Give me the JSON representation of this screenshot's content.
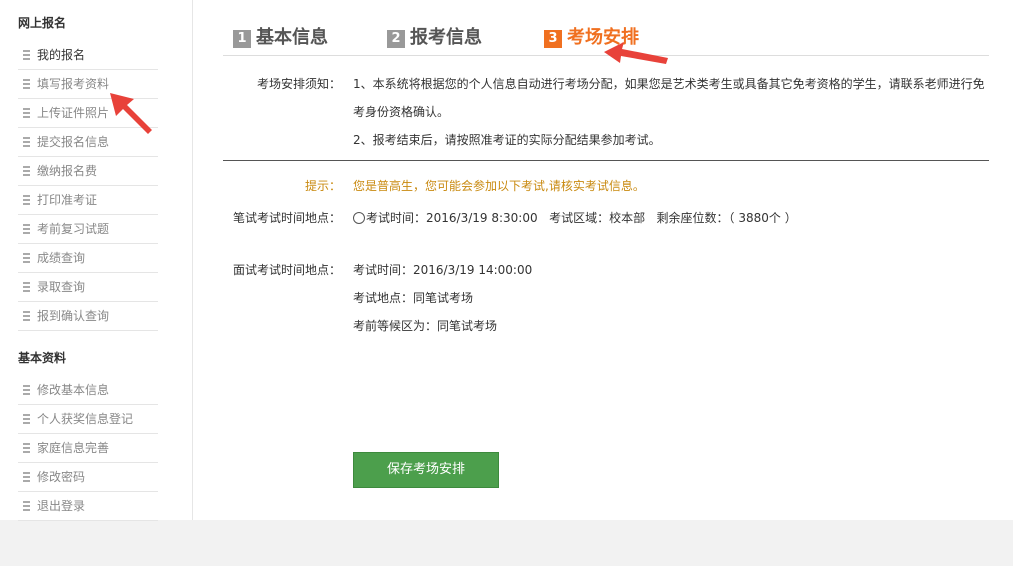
{
  "sidebar": {
    "section1_title": "网上报名",
    "section1_items": [
      "我的报名",
      "填写报考资料",
      "上传证件照片",
      "提交报名信息",
      "缴纳报名费",
      "打印准考证",
      "考前复习试题",
      "成绩查询",
      "录取查询",
      "报到确认查询"
    ],
    "section2_title": "基本资料",
    "section2_items": [
      "修改基本信息",
      "个人获奖信息登记",
      "家庭信息完善",
      "修改密码",
      "退出登录"
    ]
  },
  "steps": [
    {
      "num": "1",
      "label": "基本信息"
    },
    {
      "num": "2",
      "label": "报考信息"
    },
    {
      "num": "3",
      "label": "考场安排"
    }
  ],
  "notice": {
    "label": "考场安排须知：",
    "line1": "1、本系统将根据您的个人信息自动进行考场分配，如果您是艺术类考生或具备其它免考资格的学生，请联系老师进行免",
    "line1b": "考身份资格确认。",
    "line2": "2、报考结束后，请按照准考证的实际分配结果参加考试。"
  },
  "hint": {
    "label": "提示：",
    "text": "您是普高生，您可能会参加以下考试,请核实考试信息。"
  },
  "written": {
    "label": "笔试考试时间地点：",
    "time": "考试时间：2016/3/19 8:30:00",
    "area": "考试区域：校本部",
    "seats": "剩余座位数：（ 3880个 ）"
  },
  "interview": {
    "label": "面试考试时间地点：",
    "time": "考试时间：2016/3/19 14:00:00",
    "place": "考试地点：同笔试考场",
    "waiting": "考前等候区为：同笔试考场"
  },
  "save_label": "保存考场安排",
  "colors": {
    "accent": "#f07020",
    "button": "#4c9f4c",
    "hint": "#c98a10",
    "arrow": "#e8423a"
  }
}
